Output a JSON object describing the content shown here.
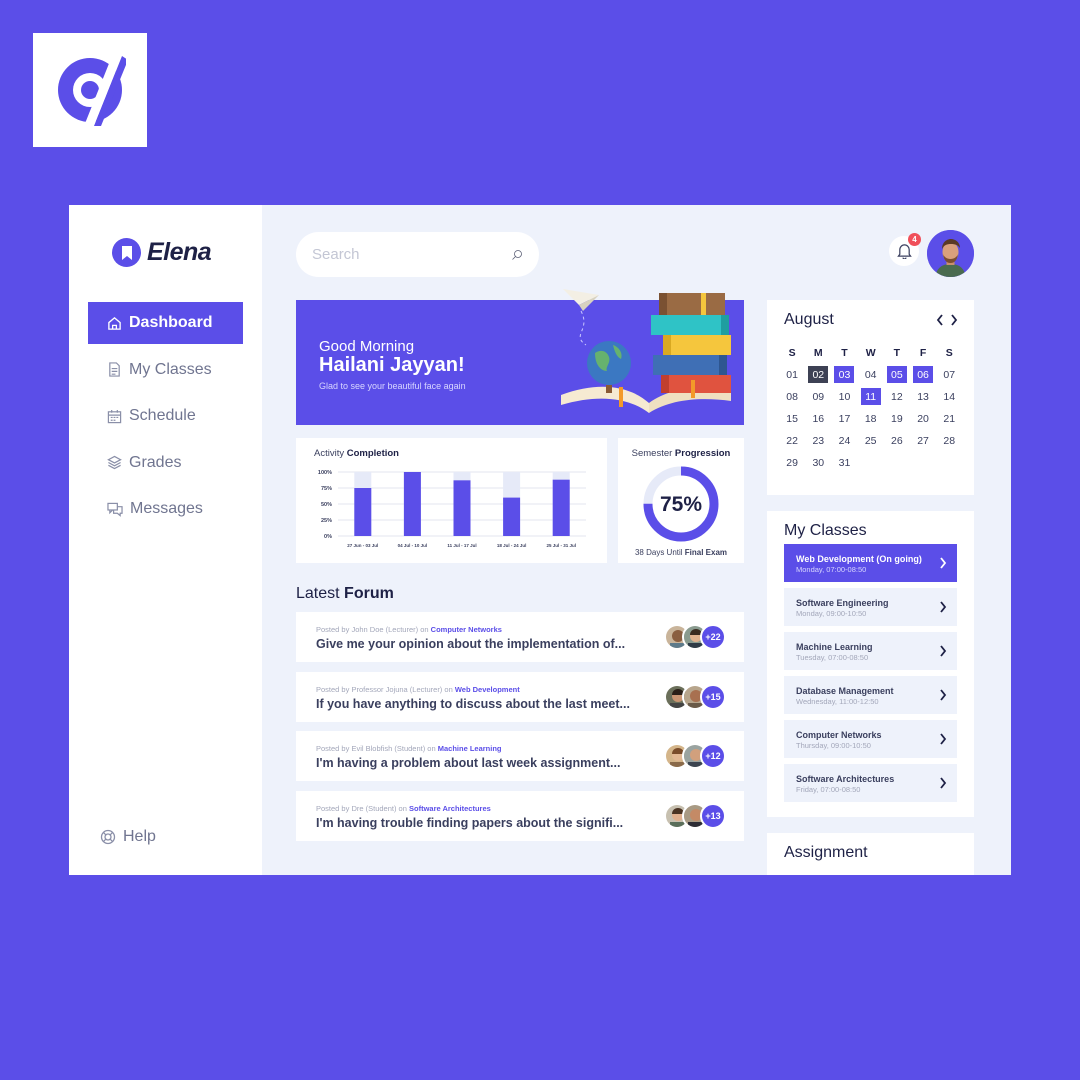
{
  "app": {
    "name": "Elena"
  },
  "colors": {
    "accent": "#5b4ee8",
    "background": "#eef2fb",
    "badge": "#f0505a"
  },
  "sidebar": {
    "items": [
      {
        "label": "Dashboard",
        "icon": "home-icon",
        "active": true
      },
      {
        "label": "My Classes",
        "icon": "document-icon",
        "active": false
      },
      {
        "label": "Schedule",
        "icon": "calendar-icon",
        "active": false
      },
      {
        "label": "Grades",
        "icon": "layers-icon",
        "active": false
      },
      {
        "label": "Messages",
        "icon": "chat-icon",
        "active": false
      }
    ],
    "help_label": "Help"
  },
  "header": {
    "search_placeholder": "Search",
    "notification_count": "4"
  },
  "banner": {
    "greeting": "Good Morning",
    "name": "Hailani Jayyan!",
    "subtitle": "Glad to see your beautiful face again"
  },
  "activity": {
    "title_prefix": "Activity",
    "title_bold": "Completion",
    "chart_data": {
      "type": "bar",
      "categories": [
        "27 Jun - 03 Jul",
        "04 Jul - 10 Jul",
        "11 Jul - 17 Jul",
        "18 Jul - 24 Jul",
        "25 Jul - 31 Jul"
      ],
      "values": [
        75,
        100,
        87,
        60,
        88
      ],
      "ylim": [
        0,
        100
      ],
      "yticks": [
        "100%",
        "75%",
        "50%",
        "25%",
        "0%"
      ]
    }
  },
  "semester": {
    "title_prefix": "Semester",
    "title_bold": "Progression",
    "percent_label": "75%",
    "percent_value": 75,
    "footer_prefix": "38 Days Until",
    "footer_bold": "Final Exam"
  },
  "forum": {
    "title_prefix": "Latest",
    "title_bold": "Forum",
    "items": [
      {
        "posted_by": "Posted by John Doe (Lecturer) on",
        "course": "Computer Networks",
        "text": "Give me your opinion about the implementation of...",
        "count": "+22"
      },
      {
        "posted_by": "Posted by Professor Jojuna (Lecturer) on",
        "course": "Web Development",
        "text": "If you have anything to discuss about the last meet...",
        "count": "+15"
      },
      {
        "posted_by": "Posted by Evil Blobfish (Student) on",
        "course": "Machine Learning",
        "text": "I'm having a problem about last week assignment...",
        "count": "+12"
      },
      {
        "posted_by": "Posted by Dre (Student) on",
        "course": "Software Architectures",
        "text": "I'm having trouble finding papers about the signifi...",
        "count": "+13"
      }
    ]
  },
  "calendar": {
    "month": "August",
    "days_of_week": [
      "S",
      "M",
      "T",
      "W",
      "T",
      "F",
      "S"
    ],
    "days": [
      "01",
      "02",
      "03",
      "04",
      "05",
      "06",
      "07",
      "08",
      "09",
      "10",
      "11",
      "12",
      "13",
      "14",
      "15",
      "16",
      "17",
      "18",
      "19",
      "20",
      "21",
      "22",
      "23",
      "24",
      "25",
      "26",
      "27",
      "28",
      "29",
      "30",
      "31"
    ],
    "marked_dark": [
      "02"
    ],
    "marked_accent": [
      "03",
      "05",
      "06",
      "11"
    ]
  },
  "my_classes": {
    "title": "My Classes",
    "items": [
      {
        "name": "Web Development (On going)",
        "time": "Monday, 07:00-08:50",
        "active": true
      },
      {
        "name": "Software Engineering",
        "time": "Monday, 09:00-10:50",
        "active": false
      },
      {
        "name": "Machine Learning",
        "time": "Tuesday, 07:00-08:50",
        "active": false
      },
      {
        "name": "Database Management",
        "time": "Wednesday, 11:00-12:50",
        "active": false
      },
      {
        "name": "Computer Networks",
        "time": "Thursday, 09:00-10:50",
        "active": false
      },
      {
        "name": "Software Architectures",
        "time": "Friday, 07:00-08:50",
        "active": false
      }
    ]
  },
  "assignment": {
    "title": "Assignment"
  }
}
